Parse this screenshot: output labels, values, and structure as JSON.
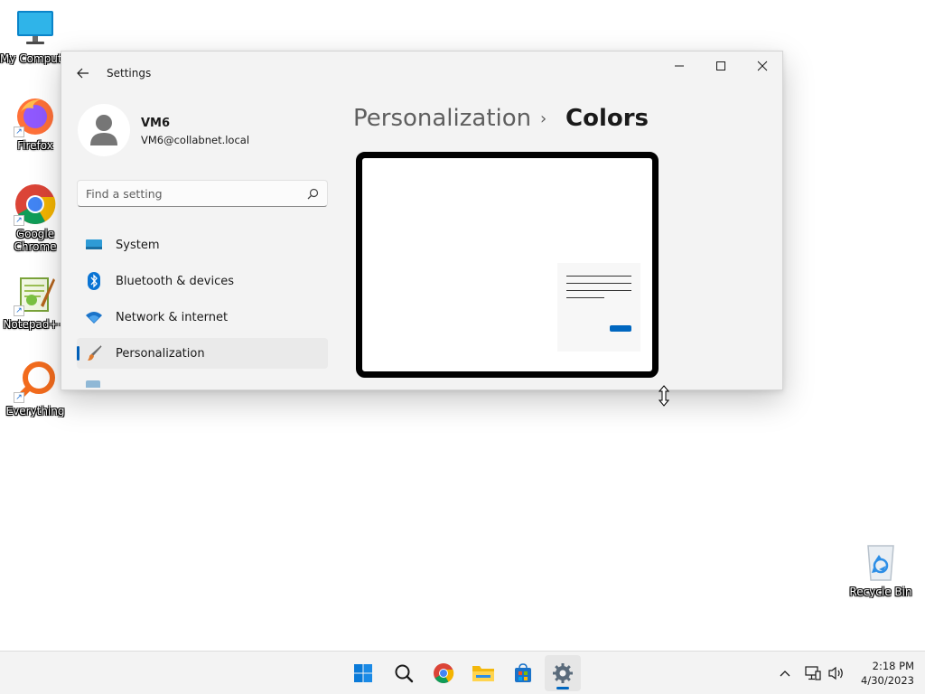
{
  "desktop": {
    "icons": [
      {
        "label": "My Computer"
      },
      {
        "label": "Firefox"
      },
      {
        "label": "Google Chrome"
      },
      {
        "label": "Notepad++"
      },
      {
        "label": "Everything"
      },
      {
        "label": "Recycle Bin"
      }
    ]
  },
  "window": {
    "title": "Settings",
    "user": {
      "name": "VM6",
      "email": "VM6@collabnet.local"
    },
    "search": {
      "placeholder": "Find a setting",
      "value": ""
    },
    "nav": [
      {
        "label": "System",
        "icon": "display-icon"
      },
      {
        "label": "Bluetooth & devices",
        "icon": "bluetooth-icon"
      },
      {
        "label": "Network & internet",
        "icon": "wifi-icon"
      },
      {
        "label": "Personalization",
        "icon": "brush-icon",
        "selected": true
      }
    ],
    "breadcrumb": {
      "parent": "Personalization",
      "separator": "›",
      "current": "Colors"
    }
  },
  "taskbar": {
    "apps": [
      "start-icon",
      "search-icon",
      "chrome-icon",
      "file-explorer-icon",
      "store-icon",
      "settings-icon"
    ],
    "clock": {
      "time": "2:18 PM",
      "date": "4/30/2023"
    }
  },
  "colors": {
    "accent": "#0067c0",
    "window_bg": "#f3f3f3",
    "selected_nav": "#eaeaea"
  }
}
